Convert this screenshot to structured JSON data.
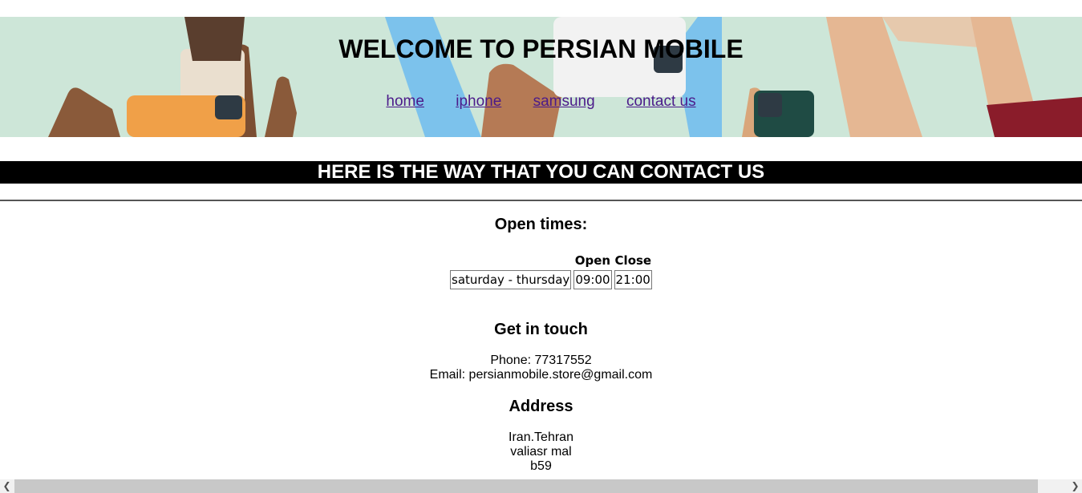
{
  "header": {
    "title": "WELCOME TO PERSIAN MOBILE",
    "nav": [
      "home",
      "iphone",
      "samsung",
      "contact us"
    ]
  },
  "contact": {
    "banner": "HERE IS THE WAY THAT YOU CAN CONTACT US",
    "open_times": {
      "heading": "Open times:",
      "columns": [
        "",
        "Open",
        "Close"
      ],
      "rows": [
        {
          "days": "saturday - thursday",
          "open": "09:00",
          "close": "21:00"
        }
      ]
    },
    "get_in_touch": {
      "heading": "Get in touch",
      "phone": "Phone: 77317552",
      "email": "Email: persianmobile.store@gmail.com"
    },
    "address": {
      "heading": "Address",
      "lines": [
        "Iran.Tehran",
        "valiasr mal",
        "b59"
      ]
    }
  },
  "colors": {
    "banner_bg": "#cde6d8",
    "contact_bar_bg": "#000000",
    "link": "#4b1a8a"
  },
  "scrollbar": {
    "left_icon": "chevron-left-icon",
    "right_icon": "chevron-right-icon"
  }
}
